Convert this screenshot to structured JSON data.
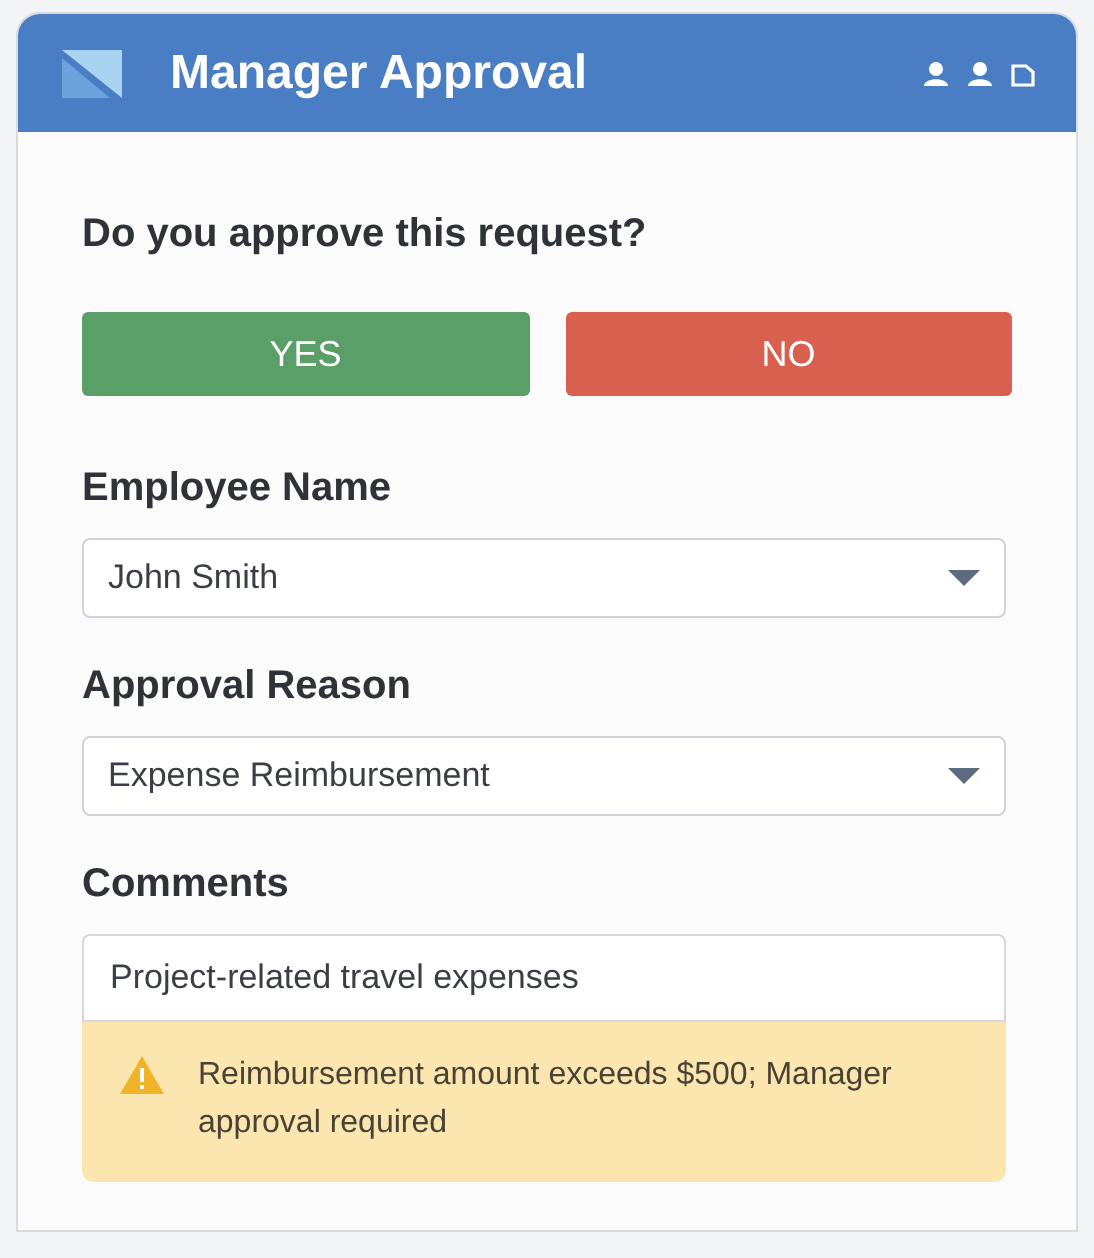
{
  "window": {
    "title": "Manager Approval"
  },
  "question": "Do you approve this request?",
  "buttons": [
    {
      "label": "YES",
      "kind": "approve"
    },
    {
      "label": "NO",
      "kind": "reject"
    }
  ],
  "fields": [
    {
      "label": "Employee Name",
      "kind": "select",
      "value": "John Smith"
    },
    {
      "label": "Approval Reason",
      "kind": "select",
      "value": "Expense Reimbursement"
    },
    {
      "label": "Comments",
      "kind": "text",
      "value": "Project-related travel expenses"
    }
  ],
  "warning": "Reimbursement amount exceeds $500; Manager approval required"
}
